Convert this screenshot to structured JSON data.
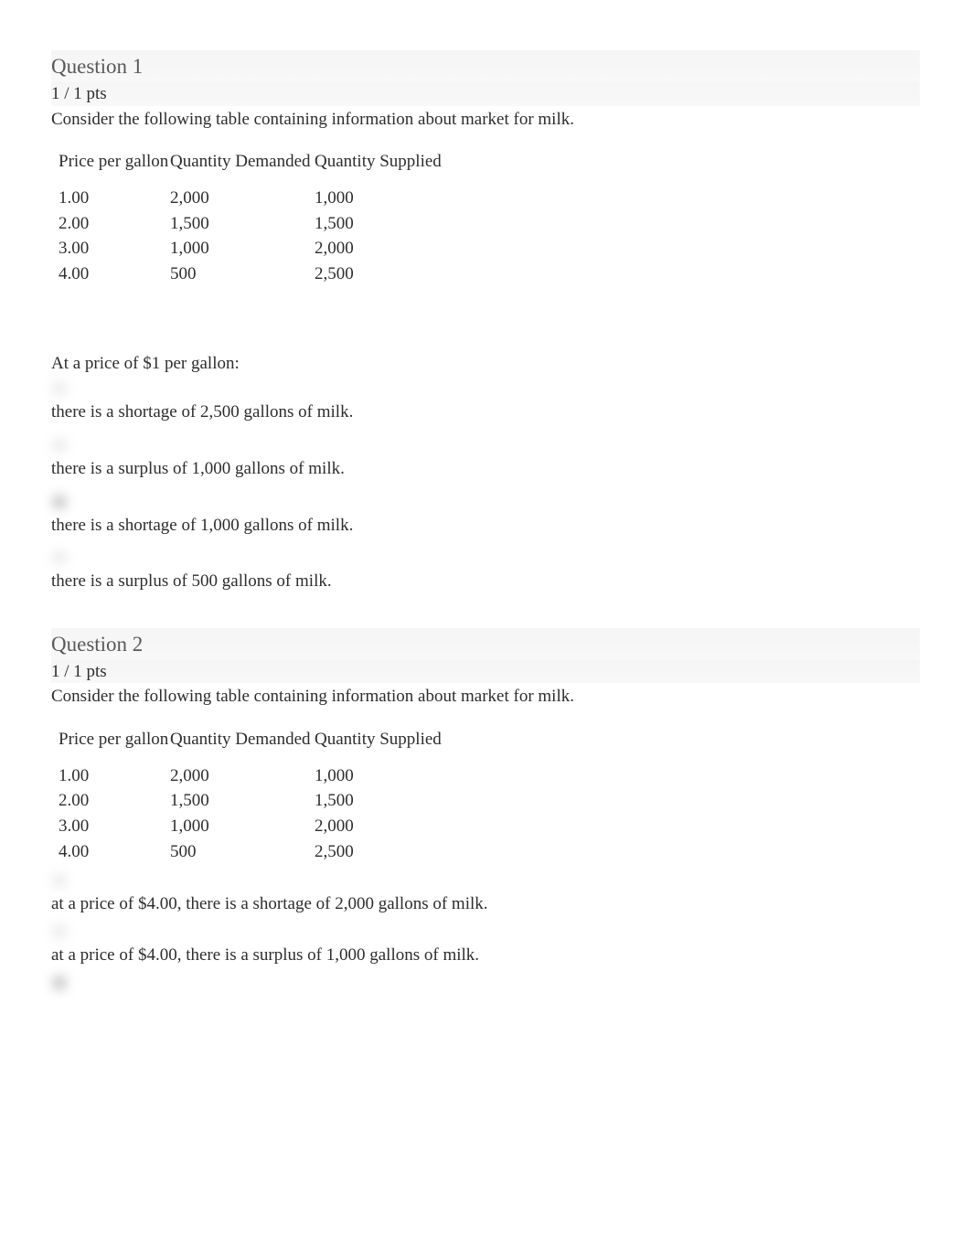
{
  "q1": {
    "title": "Question 1",
    "pts": "1 / 1 pts",
    "prompt": "Consider the following table containing information about market for milk.",
    "table": {
      "headers": {
        "price": "Price per gallon",
        "qd": "Quantity Demanded",
        "qs": "Quantity Supplied"
      },
      "rows": [
        {
          "price": "1.00",
          "qd": "2,000",
          "qs": "1,000"
        },
        {
          "price": "2.00",
          "qd": "1,500",
          "qs": "1,500"
        },
        {
          "price": "3.00",
          "qd": "1,000",
          "qs": "2,000"
        },
        {
          "price": "4.00",
          "qd": "500",
          "qs": "2,500"
        }
      ]
    },
    "sub": "At a price of $1 per gallon:",
    "options": [
      "there is a shortage of 2,500 gallons of milk.",
      "there is a surplus of 1,000 gallons of milk.",
      "there is a shortage of 1,000 gallons of milk.",
      "there is a surplus of 500 gallons of milk."
    ]
  },
  "q2": {
    "title": "Question 2",
    "pts": "1 / 1 pts",
    "prompt": "Consider the following table containing information about market for milk.",
    "table": {
      "headers": {
        "price": "Price per gallon",
        "qd": "Quantity Demanded",
        "qs": "Quantity Supplied"
      },
      "rows": [
        {
          "price": "1.00",
          "qd": "2,000",
          "qs": "1,000"
        },
        {
          "price": "2.00",
          "qd": "1,500",
          "qs": "1,500"
        },
        {
          "price": "3.00",
          "qd": "1,000",
          "qs": "2,000"
        },
        {
          "price": "4.00",
          "qd": "500",
          "qs": "2,500"
        }
      ]
    },
    "options": [
      "at a price of $4.00, there is a shortage of 2,000 gallons of milk.",
      "at a price of $4.00, there is a surplus of 1,000 gallons of milk."
    ]
  }
}
